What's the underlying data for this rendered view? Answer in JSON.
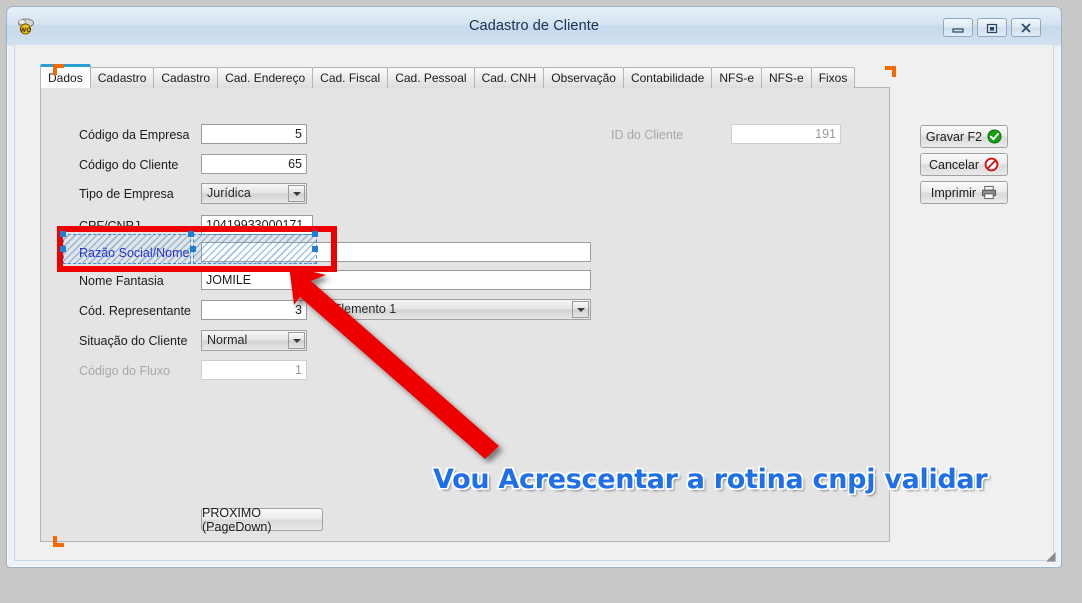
{
  "window": {
    "title": "Cadastro de Cliente",
    "app_icon": "app-icon",
    "controls": {
      "minimize": "minimize-icon",
      "maximize": "restore-icon",
      "close": "close-icon"
    }
  },
  "tabs": [
    {
      "label": "Dados",
      "active": true
    },
    {
      "label": "Cadastro",
      "active": false
    },
    {
      "label": "Cadastro",
      "active": false
    },
    {
      "label": "Cad. Endereço",
      "active": false
    },
    {
      "label": "Cad. Fiscal",
      "active": false
    },
    {
      "label": "Cad. Pessoal",
      "active": false
    },
    {
      "label": "Cad. CNH",
      "active": false
    },
    {
      "label": "Observação",
      "active": false
    },
    {
      "label": "Contabilidade",
      "active": false
    },
    {
      "label": "NFS-e",
      "active": false
    },
    {
      "label": "NFS-e",
      "active": false
    },
    {
      "label": "Fixos",
      "active": false
    }
  ],
  "form": {
    "codigo_empresa": {
      "label": "Código da Empresa",
      "value": "5"
    },
    "codigo_cliente": {
      "label": "Código do Cliente",
      "value": "65"
    },
    "tipo_empresa": {
      "label": "Tipo de Empresa",
      "value": "Jurídica"
    },
    "cpf_cnpj": {
      "label": "CPF/CNPJ",
      "value": "10419933000171"
    },
    "razao_social": {
      "label": "Razão Social/Nome",
      "value": ""
    },
    "nome_fantasia": {
      "label": "Nome Fantasia",
      "value": "JOMILE"
    },
    "cod_representante": {
      "label": "Cód. Representante",
      "value": "3"
    },
    "representante_nome": {
      "value": "Elemento 1"
    },
    "situacao_cliente": {
      "label": "Situação do Cliente",
      "value": "Normal"
    },
    "codigo_fluxo": {
      "label": "Código do Fluxo",
      "value": "1"
    },
    "id_cliente": {
      "label": "ID do Cliente",
      "value": "191"
    }
  },
  "buttons": {
    "gravar": {
      "label": "Gravar F2",
      "icon": "check-circle-icon"
    },
    "cancelar": {
      "label": "Cancelar",
      "icon": "prohibited-icon"
    },
    "imprimir": {
      "label": "Imprimir",
      "icon": "printer-icon"
    },
    "proximo": {
      "label": "PROXIMO (PageDown)"
    }
  },
  "annotation": {
    "caption": "Vou Acrescentar a rotina cnpj validar",
    "caption_color": "#1f6fe8",
    "highlight_color": "#ee0000",
    "arrow_color": "#ee0000"
  },
  "colors": {
    "design_handle": "#f56a00",
    "selection": "#1e7fd4",
    "active_tab_accent": "#2a9fd6"
  }
}
